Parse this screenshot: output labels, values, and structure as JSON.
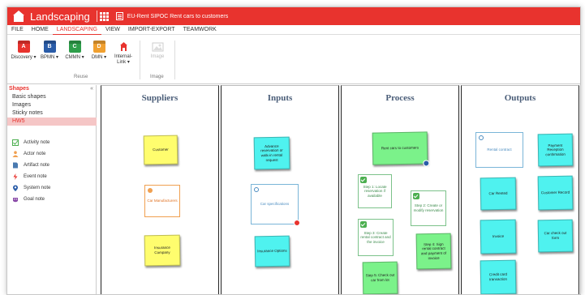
{
  "titlebar": {
    "app_title": "Landscaping",
    "document_title": "EU-Rent SIPOC Rent cars to customers"
  },
  "menu": [
    "FILE",
    "HOME",
    "LANDSCAPING",
    "VIEW",
    "IMPORT-EXPORT",
    "TEAMWORK"
  ],
  "active_menu_index": 2,
  "ribbon": {
    "buttons": [
      {
        "label": "Discovery",
        "glyph": "A",
        "color": "#e8332e",
        "icon": "discovery-icon"
      },
      {
        "label": "BPMN",
        "glyph": "B",
        "color": "#2a5ca8",
        "icon": "bpmn-icon"
      },
      {
        "label": "CMMN",
        "glyph": "C",
        "color": "#2e9e4a",
        "icon": "cmmn-icon"
      },
      {
        "label": "DMN",
        "glyph": "D",
        "color": "#f0a030",
        "icon": "dmn-icon"
      },
      {
        "label": "Internal-",
        "label2": "Link",
        "glyph": "",
        "color": "#e8332e",
        "icon": "internal-link-icon"
      }
    ],
    "image_label": "Image",
    "group_reuse": "Reuse",
    "group_image": "Image"
  },
  "sidebar": {
    "header": "Shapes",
    "collapse": "«",
    "libraries": [
      "Basic shapes",
      "Images",
      "Sticky notes",
      "HW5"
    ],
    "selected_library": 3,
    "notes": [
      {
        "label": "Activity note",
        "icon": "activity-note-icon",
        "color": "#4caf50"
      },
      {
        "label": "Actor note",
        "icon": "actor-note-icon",
        "color": "#f0a050"
      },
      {
        "label": "Artifact note",
        "icon": "artifact-note-icon",
        "color": "#4a7ab0"
      },
      {
        "label": "Event note",
        "icon": "event-note-icon",
        "color": "#e8332e"
      },
      {
        "label": "System note",
        "icon": "system-note-icon",
        "color": "#2a5ca8"
      },
      {
        "label": "Goal note",
        "icon": "goal-note-icon",
        "color": "#8a4aa8"
      }
    ]
  },
  "lanes": [
    {
      "title": "Suppliers"
    },
    {
      "title": "Inputs"
    },
    {
      "title": "Process"
    },
    {
      "title": "Outputs"
    }
  ],
  "notes": {
    "customer": "Customer",
    "car_manufacturers": "Car Manufacturers",
    "insurance_company": "Insurance Company",
    "advance_reservation": "Advance reservation or walk-in rental request",
    "car_specifications": "Car specifications",
    "insurance_options": "Insurance Options",
    "rent_cars": "Rent cars to customers",
    "step1": "Step 1: Locate reservation if available",
    "step2": "Step 2: Create or modify reservation",
    "step3": "Step 3: Create rental contract and the invoice",
    "step4": "Step 4: Sign rental contract and payment of invoice",
    "step5": "Step 5: Check out car from lot",
    "rental_contract": "Rental contract",
    "payment_reception": "Payment Reception confirmation",
    "car_rented": "Car Rented",
    "customer_record": "Customer Record",
    "invoice": "Invoice",
    "car_check_out_form": "Car check out form",
    "credit_card_transaction": "Credit card transaction"
  }
}
